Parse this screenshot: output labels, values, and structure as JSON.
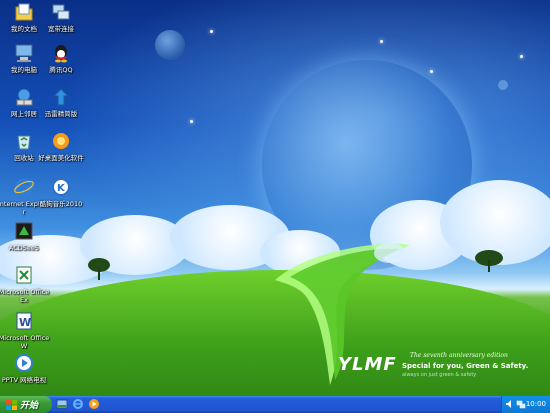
{
  "desktop": {
    "icons": [
      {
        "label": "我的文档",
        "icon": "my-documents-icon"
      },
      {
        "label": "宽带连接",
        "icon": "broadband-connection-icon"
      },
      {
        "label": "我的电脑",
        "icon": "my-computer-icon"
      },
      {
        "label": "腾讯QQ",
        "icon": "qq-icon"
      },
      {
        "label": "网上邻居",
        "icon": "network-places-icon"
      },
      {
        "label": "迅雷精简版",
        "icon": "xunlei-icon"
      },
      {
        "label": "回收站",
        "icon": "recycle-bin-icon"
      },
      {
        "label": "好桌面美化软件",
        "icon": "desktop-beautify-icon"
      },
      {
        "label": "Internet Explorer",
        "icon": "internet-explorer-icon"
      },
      {
        "label": "酷狗音乐2010",
        "icon": "kugou-music-icon"
      },
      {
        "label": "ACDSee5",
        "icon": "acdsee-icon"
      },
      {
        "label": "Microsoft Office Ex",
        "icon": "excel-icon"
      },
      {
        "label": "Microsoft Office W",
        "icon": "word-icon"
      },
      {
        "label": "PPTV 网络电视",
        "icon": "pptv-icon"
      }
    ]
  },
  "wallpaper": {
    "logo": "YLMF",
    "edition": "The seventh anniversary edition",
    "tagline": "Special for you, Green & Safety.",
    "subtext": "always on just green & safety"
  },
  "taskbar": {
    "start_label": "开始",
    "quick_launch": [
      "show-desktop-icon",
      "internet-explorer-icon",
      "media-player-icon"
    ],
    "tray_icons": [
      "volume-icon",
      "network-icon"
    ],
    "clock": "10:00"
  },
  "colors": {
    "taskbar_blue": "#245edb",
    "start_green": "#3b9c37",
    "tray_blue": "#0c77d4"
  }
}
